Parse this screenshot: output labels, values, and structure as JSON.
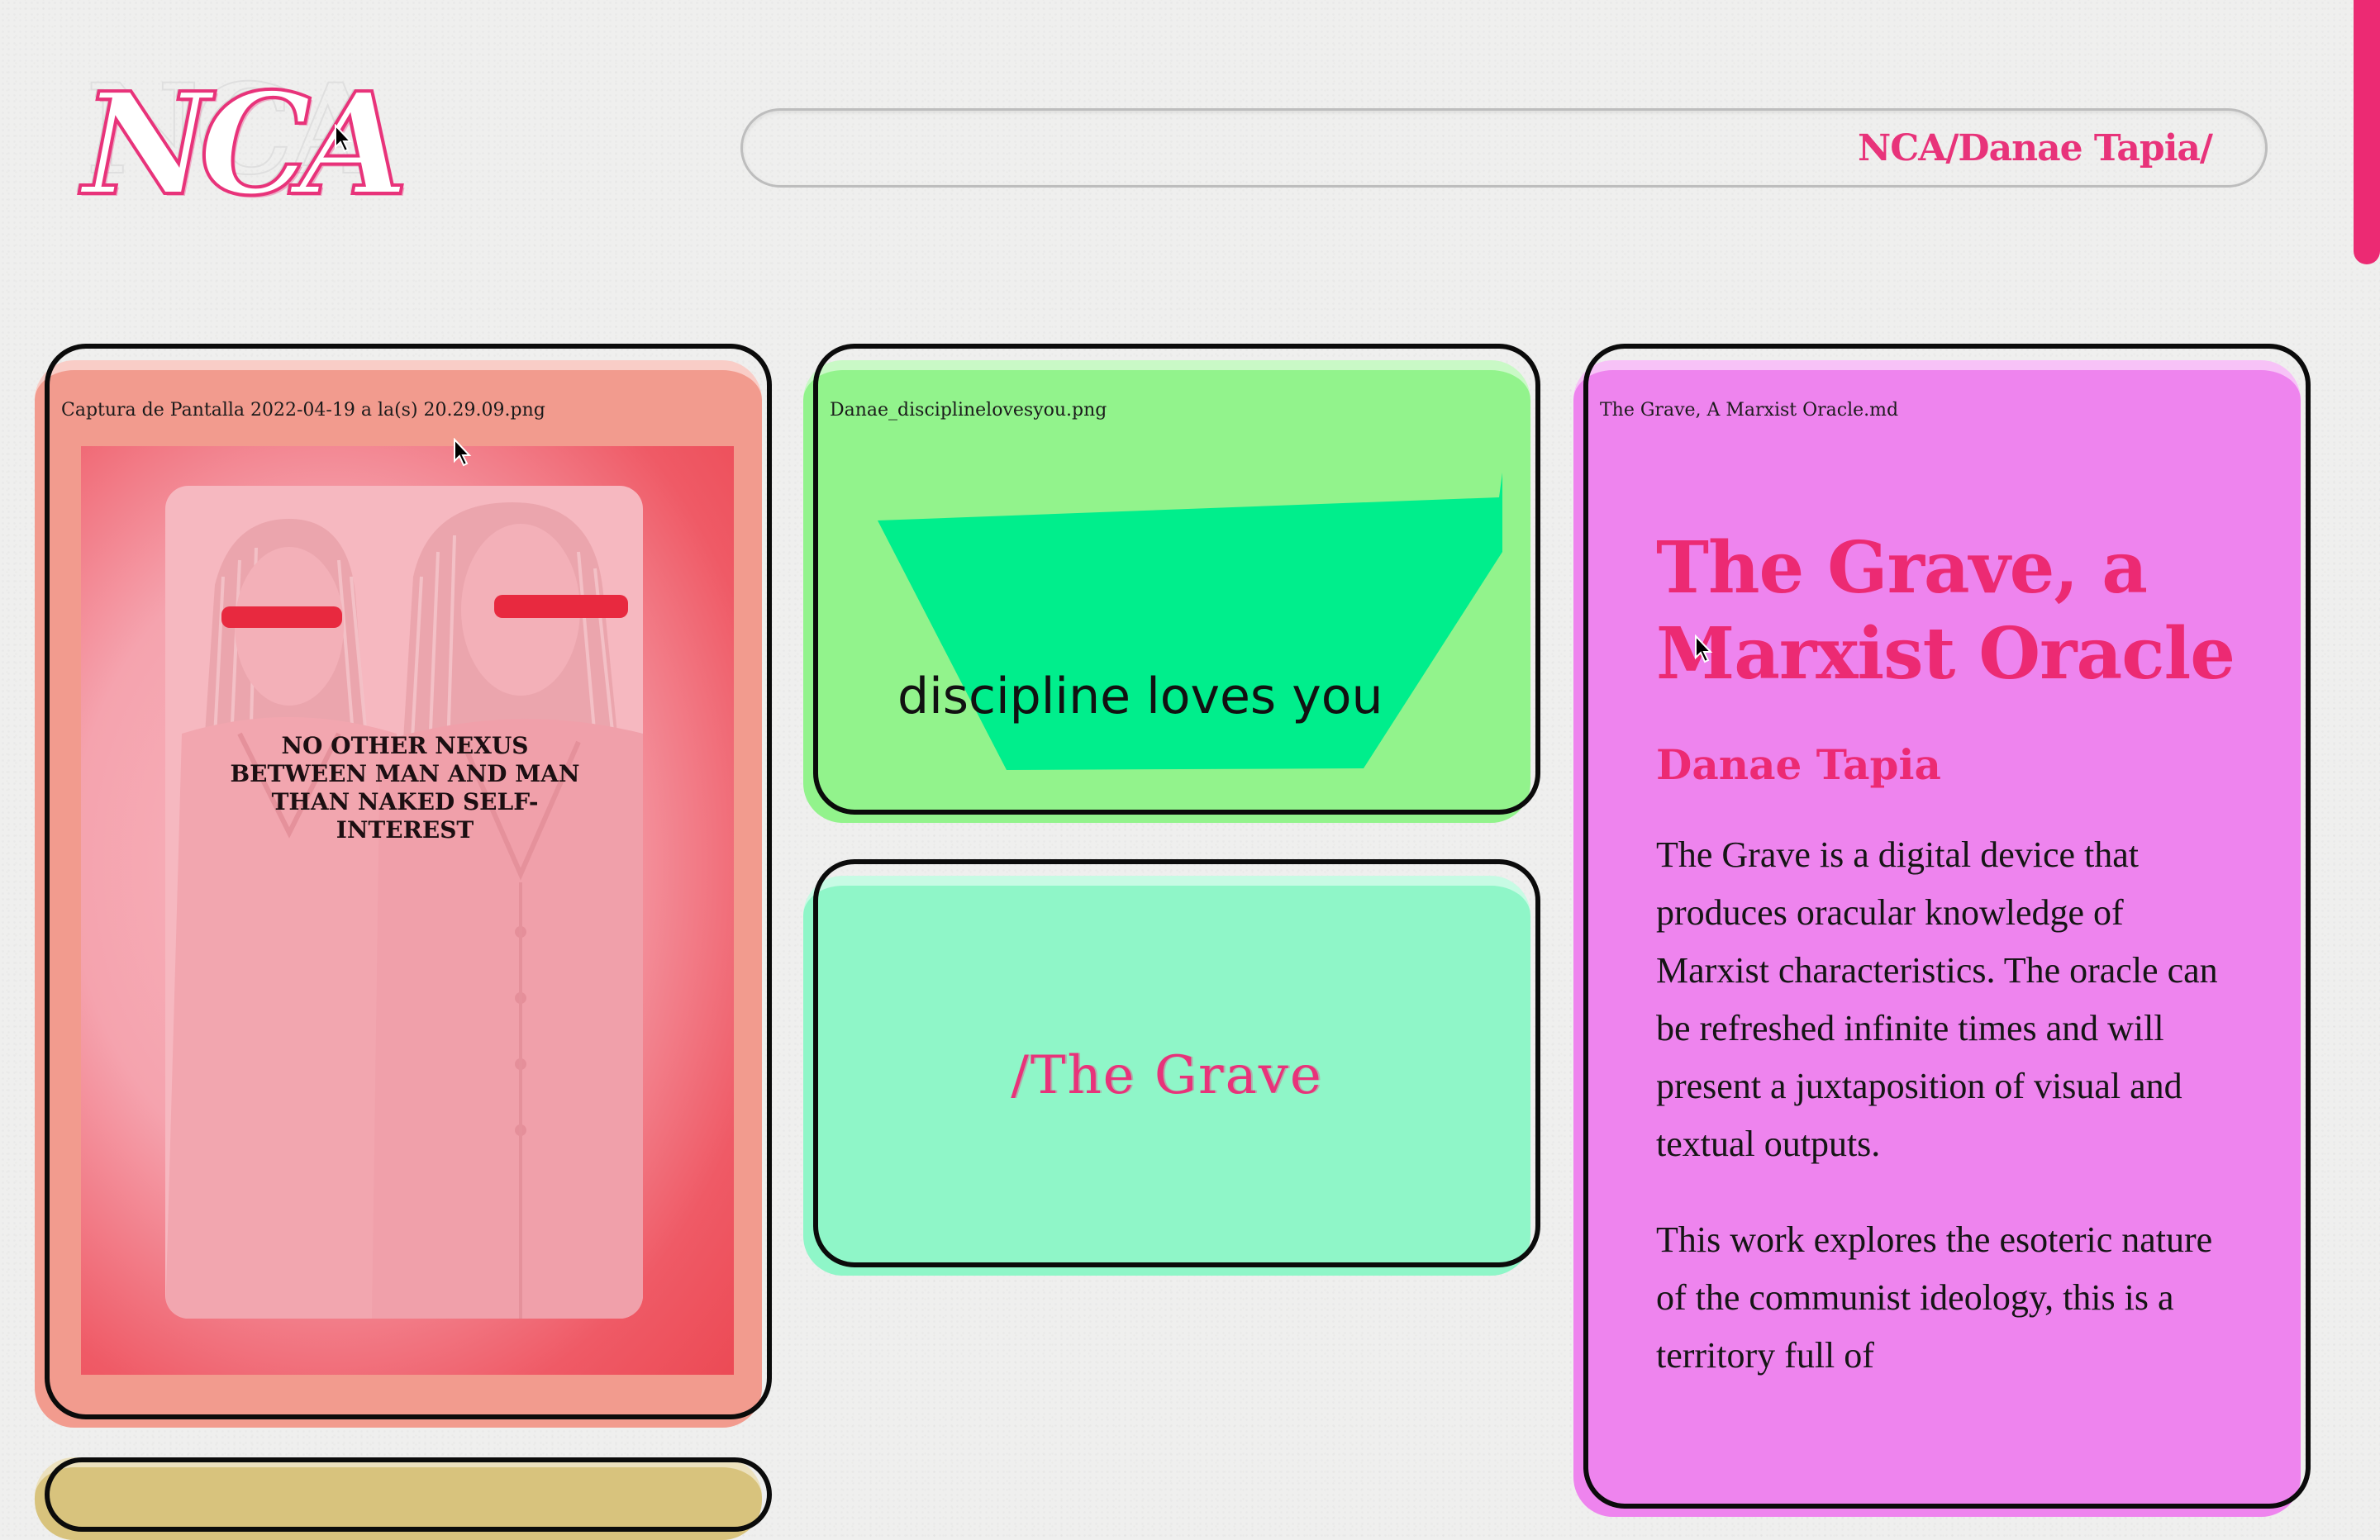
{
  "header": {
    "logo_text": "NCA",
    "path": "NCA/Danae Tapia/"
  },
  "cards": {
    "image1": {
      "filename": "Captura de Pantalla 2022-04-19 a la(s) 20.29.09.png",
      "poster_text": "NO OTHER NEXUS BETWEEN MAN AND MAN THAN NAKED SELF-INTEREST"
    },
    "image2": {
      "filename": "Danae_disciplinelovesyou.png",
      "caption": "discipline loves you"
    },
    "link": {
      "label": "/The Grave"
    },
    "text": {
      "filename": "The Grave, A Marxist Oracle.md",
      "title": "The Grave, a Marxist Oracle",
      "author": "Danae Tapia",
      "paragraphs": [
        "The Grave is a digital device that produces oracular knowledge of Marxist characteristics. The oracle can be refreshed infinite times and will present a juxtaposition of visual and textual outputs.",
        "This work explores the esoteric nature of the communist ideology, this is a territory full of"
      ]
    }
  },
  "colors": {
    "accent": "#ec2a73",
    "card_salmon": "#f29b8e",
    "card_green": "#92f38c",
    "card_mint": "#8ff6c8",
    "card_violet": "#ee84ee",
    "card_ochre": "#d8c37d",
    "shape_green": "#00ee8c",
    "background": "#efefee"
  },
  "icons": {
    "cursor": "arrow-pointer-icon"
  }
}
